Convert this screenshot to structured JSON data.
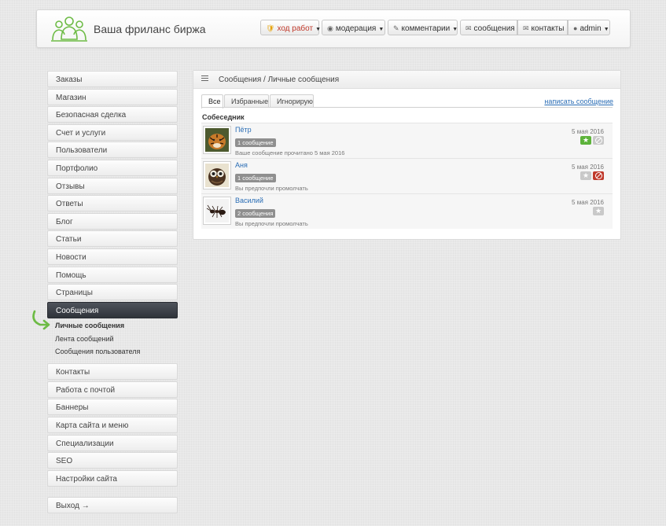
{
  "header": {
    "site_title": "Ваша фриланс биржа",
    "nav": [
      {
        "label": "ход работ",
        "icon": "shield-icon",
        "dropdown": true
      },
      {
        "label": "модерация",
        "icon": "eye-icon",
        "dropdown": true
      },
      {
        "label": "комментарии",
        "icon": "pencil-icon",
        "dropdown": true
      },
      {
        "label": "сообщения",
        "icon": "envelope-icon",
        "dropdown": false
      },
      {
        "label": "контакты",
        "icon": "envelope-icon",
        "dropdown": false
      },
      {
        "label": "admin",
        "icon": "user-icon",
        "dropdown": true
      }
    ]
  },
  "sidebar": {
    "items": [
      {
        "label": "Заказы"
      },
      {
        "label": "Магазин"
      },
      {
        "label": "Безопасная сделка"
      },
      {
        "label": "Счет и услуги"
      },
      {
        "label": "Пользователи"
      },
      {
        "label": "Портфолио"
      },
      {
        "label": "Отзывы"
      },
      {
        "label": "Ответы"
      },
      {
        "label": "Блог"
      },
      {
        "label": "Статьи"
      },
      {
        "label": "Новости"
      },
      {
        "label": "Помощь"
      },
      {
        "label": "Страницы"
      },
      {
        "label": "Сообщения",
        "active": true
      }
    ],
    "sub_items": [
      {
        "label": "Личные сообщения",
        "active": true
      },
      {
        "label": "Лента сообщений"
      },
      {
        "label": "Сообщения пользователя"
      }
    ],
    "items_after": [
      {
        "label": "Контакты"
      },
      {
        "label": "Работа с почтой"
      },
      {
        "label": "Баннеры"
      },
      {
        "label": "Карта сайта и меню"
      },
      {
        "label": "Специализации"
      },
      {
        "label": "SEO"
      },
      {
        "label": "Настройки сайта"
      }
    ],
    "logout": "Выход →"
  },
  "main": {
    "breadcrumb": "Сообщения / Личные сообщения",
    "tabs": [
      {
        "label": "Все",
        "active": true
      },
      {
        "label": "Избранные"
      },
      {
        "label": "Игнорирую"
      }
    ],
    "write_link": "написать сообщение",
    "column_header": "Собеседник",
    "conversations": [
      {
        "name": "Пётр",
        "count": "1 сообщение",
        "status": "Ваше сообщение прочитано 5 мая 2016",
        "date": "5 мая 2016",
        "avatar": "tiger",
        "favorite": true,
        "blocked": false,
        "show_block": true
      },
      {
        "name": "Аня",
        "count": "1 сообщение",
        "status": "Вы предпочли промолчать",
        "date": "5 мая 2016",
        "avatar": "owl",
        "favorite": false,
        "blocked": true,
        "show_block": true
      },
      {
        "name": "Василий",
        "count": "2 сообщения",
        "status": "Вы предпочли промолчать",
        "date": "5 мая 2016",
        "avatar": "ant",
        "favorite": false,
        "blocked": false,
        "show_block": false
      }
    ]
  },
  "colors": {
    "accent_link": "#2a6db5",
    "active_sidebar": "#3a3e45",
    "favorite_green": "#5db33b",
    "block_red": "#c0392b",
    "logo_green": "#6dbb45"
  }
}
